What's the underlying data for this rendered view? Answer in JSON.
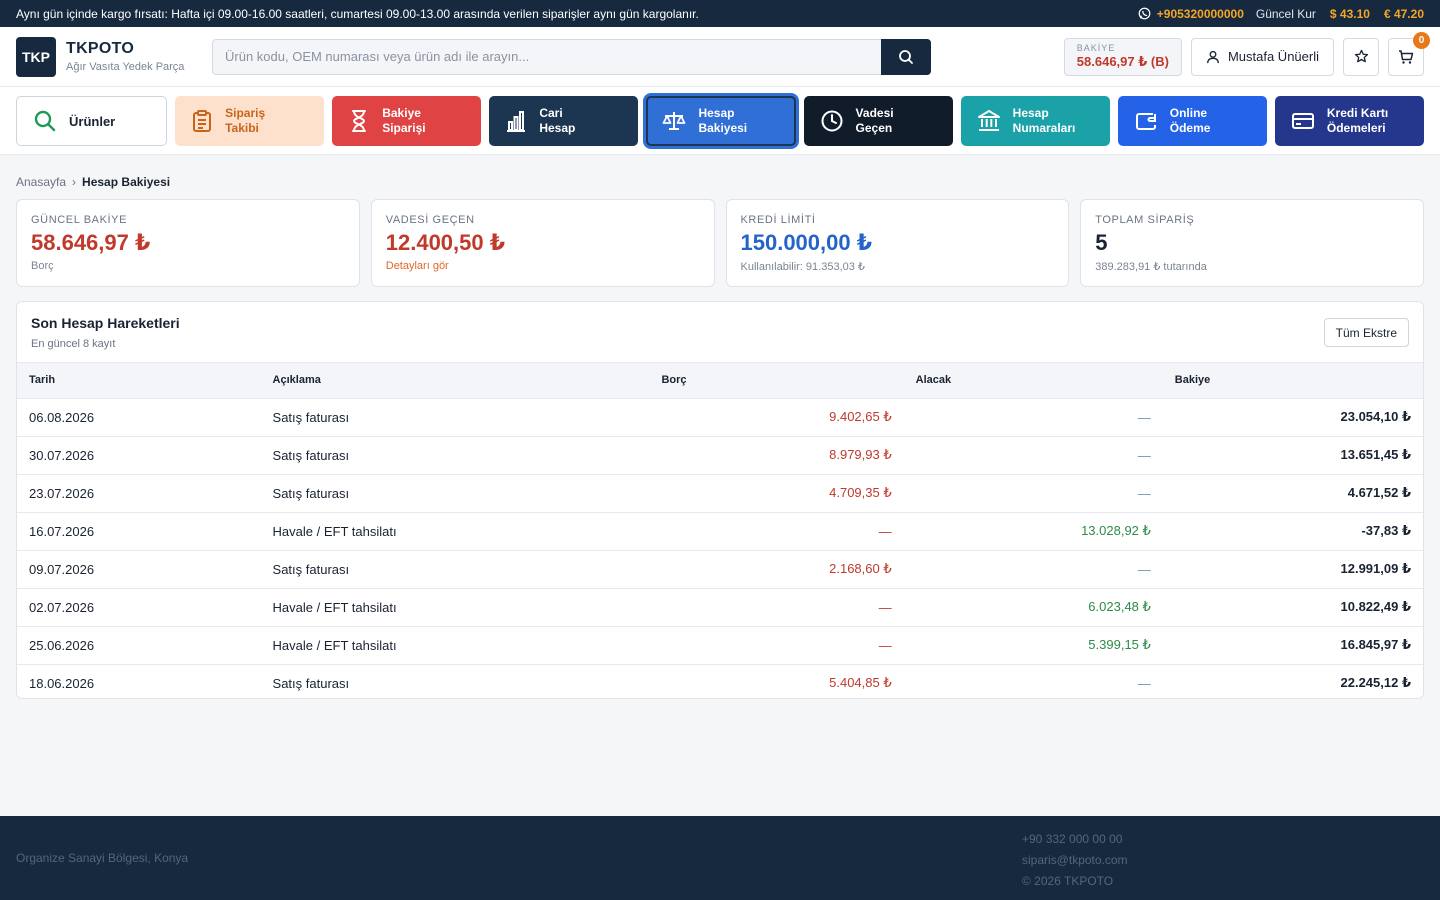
{
  "topbar": {
    "promo": "Aynı gün içinde kargo fırsatı: Hafta içi 09.00-16.00 saatleri, cumartesi 09.00-13.00 arasında verilen siparişler aynı gün kargolanır.",
    "phone": "+905320000000",
    "rate_label": "Güncel Kur",
    "usd": "$ 43.10",
    "eur": "€ 47.20"
  },
  "header": {
    "logo_text": "TKP",
    "brand_name": "TKPOTO",
    "brand_sub": "Ağır Vasıta Yedek Parça",
    "search_placeholder": "Ürün kodu, OEM numarası veya ürün adı ile arayın...",
    "balance_label": "BAKİYE",
    "balance_value": "58.646,97 ₺ (B)",
    "user_name": "Mustafa Ünüerli",
    "cart_count": "0"
  },
  "nav": {
    "items": [
      {
        "label": "Ürünler"
      },
      {
        "label": "Sipariş\nTakibi"
      },
      {
        "label": "Bakiye\nSiparişi"
      },
      {
        "label": "Cari\nHesap"
      },
      {
        "label": "Hesap\nBakiyesi"
      },
      {
        "label": "Vadesi\nGeçen"
      },
      {
        "label": "Hesap\nNumaraları"
      },
      {
        "label": "Online\nÖdeme"
      },
      {
        "label": "Kredi Kartı\nÖdemeleri"
      }
    ]
  },
  "breadcrumb": {
    "home": "Anasayfa",
    "sep": "›",
    "current": "Hesap Bakiyesi"
  },
  "cards": [
    {
      "label": "GÜNCEL BAKİYE",
      "value": "58.646,97 ₺",
      "sub": "Borç",
      "color": "#c0392b",
      "sub_color": "#7b8594"
    },
    {
      "label": "VADESİ GEÇEN",
      "value": "12.400,50 ₺",
      "sub": "Detayları gör",
      "color": "#c0392b",
      "sub_color": "#e0682a"
    },
    {
      "label": "KREDİ LİMİTİ",
      "value": "150.000,00 ₺",
      "sub": "Kullanılabilir: 91.353,03 ₺",
      "color": "#2463c8",
      "sub_color": "#7b8594"
    },
    {
      "label": "TOPLAM SİPARİŞ",
      "value": "5",
      "sub": "389.283,91 ₺ tutarında",
      "color": "#1a2332",
      "sub_color": "#7b8594"
    }
  ],
  "transactions": {
    "title": "Son Hesap Hareketleri",
    "subtitle": "En güncel 8 kayıt",
    "button": "Tüm Ekstre",
    "columns": [
      "Tarih",
      "Açıklama",
      "Borç",
      "Alacak",
      "Bakiye"
    ],
    "rows": [
      {
        "date": "06.08.2026",
        "desc": "Satış faturası",
        "borc": "9.402,65 ₺",
        "alacak": "—",
        "bakiye": "23.054,10 ₺"
      },
      {
        "date": "30.07.2026",
        "desc": "Satış faturası",
        "borc": "8.979,93 ₺",
        "alacak": "—",
        "bakiye": "13.651,45 ₺"
      },
      {
        "date": "23.07.2026",
        "desc": "Satış faturası",
        "borc": "4.709,35 ₺",
        "alacak": "—",
        "bakiye": "4.671,52 ₺"
      },
      {
        "date": "16.07.2026",
        "desc": "Havale / EFT tahsilatı",
        "borc": "—",
        "alacak": "13.028,92 ₺",
        "bakiye": "-37,83 ₺"
      },
      {
        "date": "09.07.2026",
        "desc": "Satış faturası",
        "borc": "2.168,60 ₺",
        "alacak": "—",
        "bakiye": "12.991,09 ₺"
      },
      {
        "date": "02.07.2026",
        "desc": "Havale / EFT tahsilatı",
        "borc": "—",
        "alacak": "6.023,48 ₺",
        "bakiye": "10.822,49 ₺"
      },
      {
        "date": "25.06.2026",
        "desc": "Havale / EFT tahsilatı",
        "borc": "—",
        "alacak": "5.399,15 ₺",
        "bakiye": "16.845,97 ₺"
      },
      {
        "date": "18.06.2026",
        "desc": "Satış faturası",
        "borc": "5.404,85 ₺",
        "alacak": "—",
        "bakiye": "22.245,12 ₺"
      }
    ]
  },
  "footer": {
    "address": "Organize Sanayi Bölgesi, Konya",
    "phone": "+90 332 000 00 00",
    "email": "siparis@tkpoto.com",
    "copyright": "© 2026 TKPOTO"
  }
}
